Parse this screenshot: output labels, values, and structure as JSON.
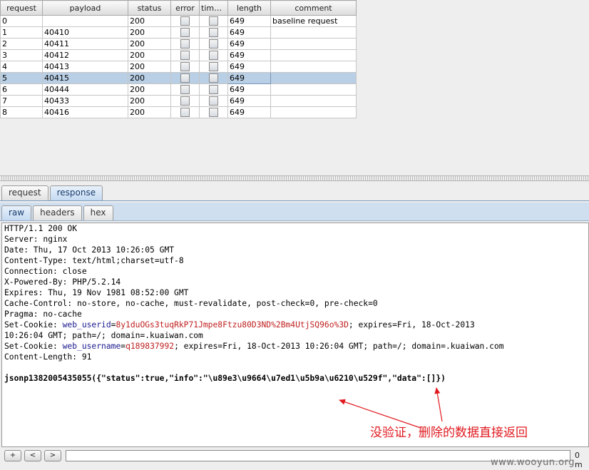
{
  "table": {
    "columns": [
      "request",
      "payload",
      "status",
      "error",
      "time...",
      "length",
      "comment"
    ],
    "rows": [
      {
        "request": "0",
        "payload": "",
        "status": "200",
        "length": "649",
        "comment": "baseline request"
      },
      {
        "request": "1",
        "payload": "40410",
        "status": "200",
        "length": "649",
        "comment": ""
      },
      {
        "request": "2",
        "payload": "40411",
        "status": "200",
        "length": "649",
        "comment": ""
      },
      {
        "request": "3",
        "payload": "40412",
        "status": "200",
        "length": "649",
        "comment": ""
      },
      {
        "request": "4",
        "payload": "40413",
        "status": "200",
        "length": "649",
        "comment": ""
      },
      {
        "request": "5",
        "payload": "40415",
        "status": "200",
        "length": "649",
        "comment": ""
      },
      {
        "request": "6",
        "payload": "40444",
        "status": "200",
        "length": "649",
        "comment": ""
      },
      {
        "request": "7",
        "payload": "40433",
        "status": "200",
        "length": "649",
        "comment": ""
      },
      {
        "request": "8",
        "payload": "40416",
        "status": "200",
        "length": "649",
        "comment": ""
      }
    ],
    "selected_row": "5"
  },
  "outer_tabs": {
    "request": "request",
    "response": "response"
  },
  "inner_tabs": {
    "raw": "raw",
    "headers": "headers",
    "hex": "hex"
  },
  "response": {
    "lines": [
      "HTTP/1.1 200 OK",
      "Server: nginx",
      "Date: Thu, 17 Oct 2013 10:26:05 GMT",
      "Content-Type: text/html;charset=utf-8",
      "Connection: close",
      "X-Powered-By: PHP/5.2.14",
      "Expires: Thu, 19 Nov 1981 08:52:00 GMT",
      "Cache-Control: no-store, no-cache, must-revalidate, post-check=0, pre-check=0",
      "Pragma: no-cache"
    ],
    "cookie1": {
      "prefix": "Set-Cookie: ",
      "name": "web_userid",
      "eq": "=",
      "value": "8y1duOGs3tuqRkP71Jmpe8Ftzu80D3ND%2Bm4UtjSQ96o%3D",
      "rest": "; expires=Fri, 18-Oct-2013",
      "cont": "10:26:04 GMT; path=/; domain=.kuaiwan.com"
    },
    "cookie2": {
      "prefix": "Set-Cookie: ",
      "name": "web_username",
      "eq": "=",
      "value": "q189837992",
      "rest": "; expires=Fri, 18-Oct-2013 10:26:04 GMT; path=/; domain=.kuaiwan.com"
    },
    "content_length": "Content-Length: 91",
    "body": "jsonp1382005435055({\"status\":true,\"info\":\"\\u89e3\\u9664\\u7ed1\\u5b9a\\u6210\\u529f\",\"data\":[]})"
  },
  "annotation": {
    "text": "没验证，删除的数据直接返回",
    "color": "#e0191f"
  },
  "search": {
    "prev_label": "+",
    "back_label": "<",
    "next_label": ">",
    "value": "",
    "match_count": "0 m"
  },
  "watermark": "www.wooyun.org"
}
